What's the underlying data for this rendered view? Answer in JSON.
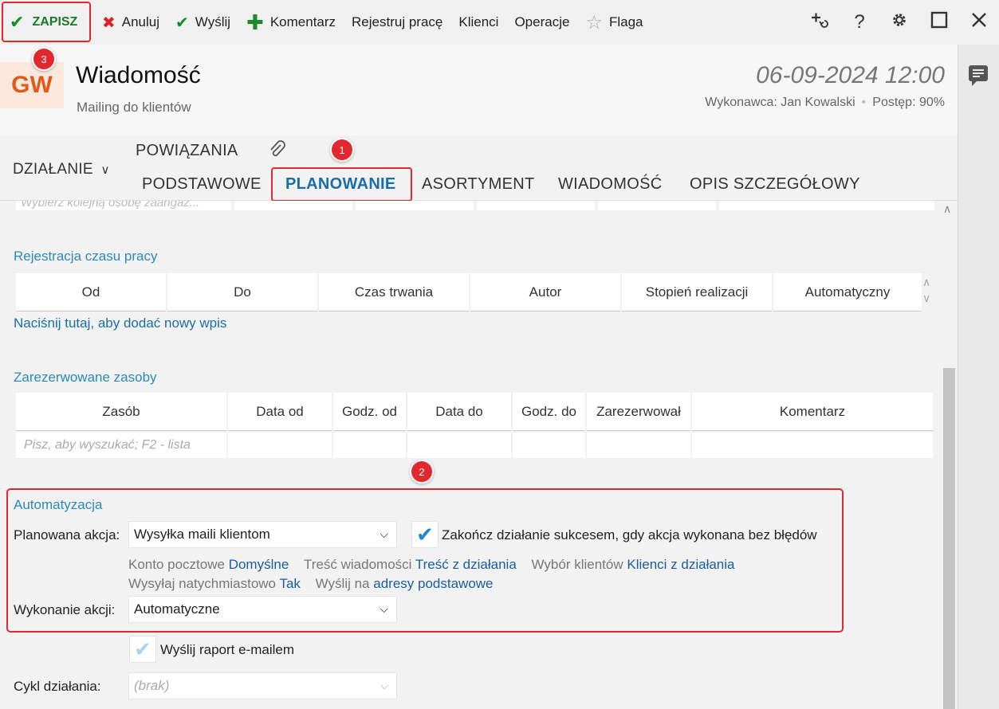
{
  "toolbar": {
    "save": "ZAPISZ",
    "cancel": "Anuluj",
    "send": "Wyślij",
    "comment": "Komentarz",
    "register_work": "Rejestruj pracę",
    "clients": "Klienci",
    "operations": "Operacje",
    "flag": "Flaga",
    "icons": [
      "add-link-icon",
      "help-icon",
      "gear-icon",
      "maximize-icon",
      "close-icon"
    ],
    "help_glyph": "?"
  },
  "header": {
    "avatar": "GW",
    "title": "Wiadomość",
    "subtitle": "Mailing do klientów",
    "date": "06-09-2024 12:00",
    "executor": "Wykonawca: Jan Kowalski",
    "progress": "Postęp: 90%"
  },
  "tabs": {
    "action": "DZIAŁANIE",
    "relations": "POWIĄZANIA",
    "basic": "PODSTAWOWE",
    "planning": "PLANOWANIE",
    "assortment": "ASORTYMENT",
    "message": "WIADOMOŚĆ",
    "details": "OPIS SZCZEGÓŁOWY",
    "active": "PLANOWANIE"
  },
  "badges": {
    "b1": "1",
    "b2": "2",
    "b3": "3"
  },
  "participants": {
    "placeholder": "Wybierz kolejną osobę zaangaż..."
  },
  "time_registration": {
    "title": "Rejestracja czasu pracy",
    "columns": [
      "Od",
      "Do",
      "Czas trwania",
      "Autor",
      "Stopień realizacji",
      "Automatyczny"
    ],
    "add_link": "Naciśnij tutaj, aby dodać nowy wpis"
  },
  "resources": {
    "title": "Zarezerwowane zasoby",
    "columns": [
      "Zasób",
      "Data od",
      "Godz. od",
      "Data do",
      "Godz. do",
      "Zarezerwował",
      "Komentarz"
    ],
    "search_placeholder": "Pisz, aby wyszukać; F2 - lista"
  },
  "automation": {
    "title": "Automatyzacja",
    "planned_action_label": "Planowana akcja:",
    "planned_action_value": "Wysyłka maili klientom",
    "finish_checkbox_label": "Zakończ działanie sukcesem, gdy akcja wykonana bez błędów",
    "finish_checked": true,
    "mail_account_label": "Konto pocztowe",
    "mail_account_value": "Domyślne",
    "message_content_label": "Treść wiadomości",
    "message_content_value": "Treść z działania",
    "client_selection_label": "Wybór klientów",
    "client_selection_value": "Klienci z działania",
    "send_immediately_label": "Wysyłaj natychmiastowo",
    "send_immediately_value": "Tak",
    "send_to_label": "Wyślij na",
    "send_to_value": "adresy podstawowe",
    "execution_label": "Wykonanie akcji:",
    "execution_value": "Automatyczne"
  },
  "report": {
    "label": "Wyślij raport e-mailem",
    "checked": true
  },
  "cycle": {
    "label": "Cykl działania:",
    "placeholder": "(brak)"
  },
  "colors": {
    "accent": "#1a6ea8",
    "section": "#2a8ab8",
    "highlight": "#e0282e",
    "ok": "#1a8a2a"
  }
}
